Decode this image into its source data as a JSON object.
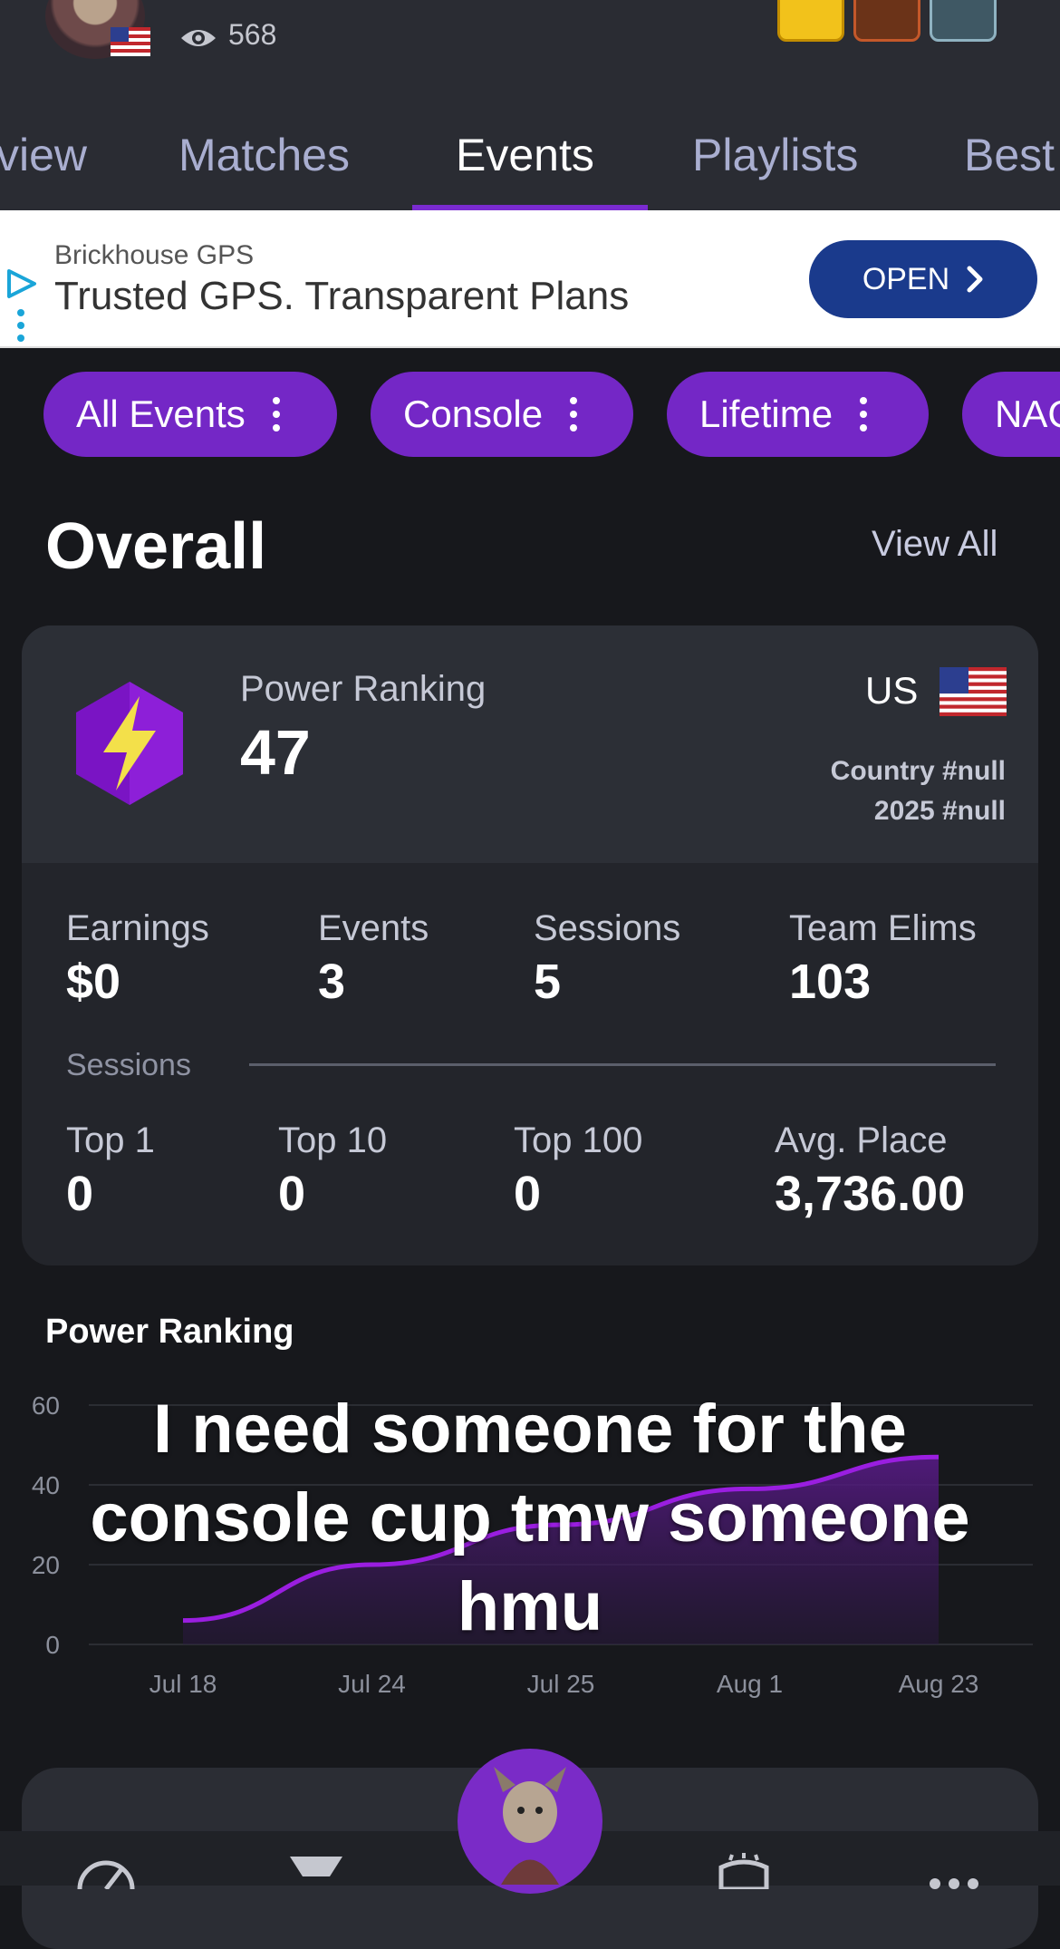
{
  "header": {
    "views": "568",
    "tabs": [
      "view",
      "Matches",
      "Events",
      "Playlists",
      "Best"
    ],
    "active_tab": "Events"
  },
  "ad": {
    "source": "Brickhouse GPS",
    "title": "Trusted GPS. Transparent Plans",
    "button_label": "OPEN"
  },
  "filters": [
    "All Events",
    "Console",
    "Lifetime",
    "NAC"
  ],
  "overall": {
    "title": "Overall",
    "view_all": "View All",
    "power_ranking_label": "Power Ranking",
    "power_ranking_value": "47",
    "country_code": "US",
    "country_rank": "Country #null",
    "year_rank": "2025 #null",
    "stats": [
      {
        "label": "Earnings",
        "value": "$0"
      },
      {
        "label": "Events",
        "value": "3"
      },
      {
        "label": "Sessions",
        "value": "5"
      },
      {
        "label": "Team Elims",
        "value": "103"
      }
    ],
    "sessions_label": "Sessions",
    "session_stats": [
      {
        "label": "Top 1",
        "value": "0"
      },
      {
        "label": "Top 10",
        "value": "0"
      },
      {
        "label": "Top 100",
        "value": "0"
      },
      {
        "label": "Avg. Place",
        "value": "3,736.00"
      }
    ]
  },
  "chart_section": {
    "title": "Power Ranking",
    "caption": "I need someone for the console cup tmw someone hmu"
  },
  "chart_data": {
    "type": "area",
    "title": "Power Ranking",
    "x": [
      "Jul 18",
      "Jul 24",
      "Jul 25",
      "Aug 1",
      "Aug 23"
    ],
    "series": [
      {
        "values": [
          6,
          20,
          30,
          39,
          47
        ]
      }
    ],
    "ylim": [
      0,
      60
    ],
    "yticks": [
      0,
      20,
      40,
      60
    ],
    "grid": true,
    "colors": {
      "line": "#9a1ee0",
      "fill": "#5a1a8a"
    }
  },
  "colors": {
    "accent": "#7427c6",
    "background": "#17181c",
    "card": "#23252b",
    "ad_button": "#1a3a8c"
  },
  "icons": [
    "eye-icon",
    "flag-icon",
    "lightning-hexagon-icon",
    "open-chevron-icon",
    "kebab-icon",
    "speedometer-icon",
    "trophy-icon",
    "ellipsis-icon"
  ]
}
